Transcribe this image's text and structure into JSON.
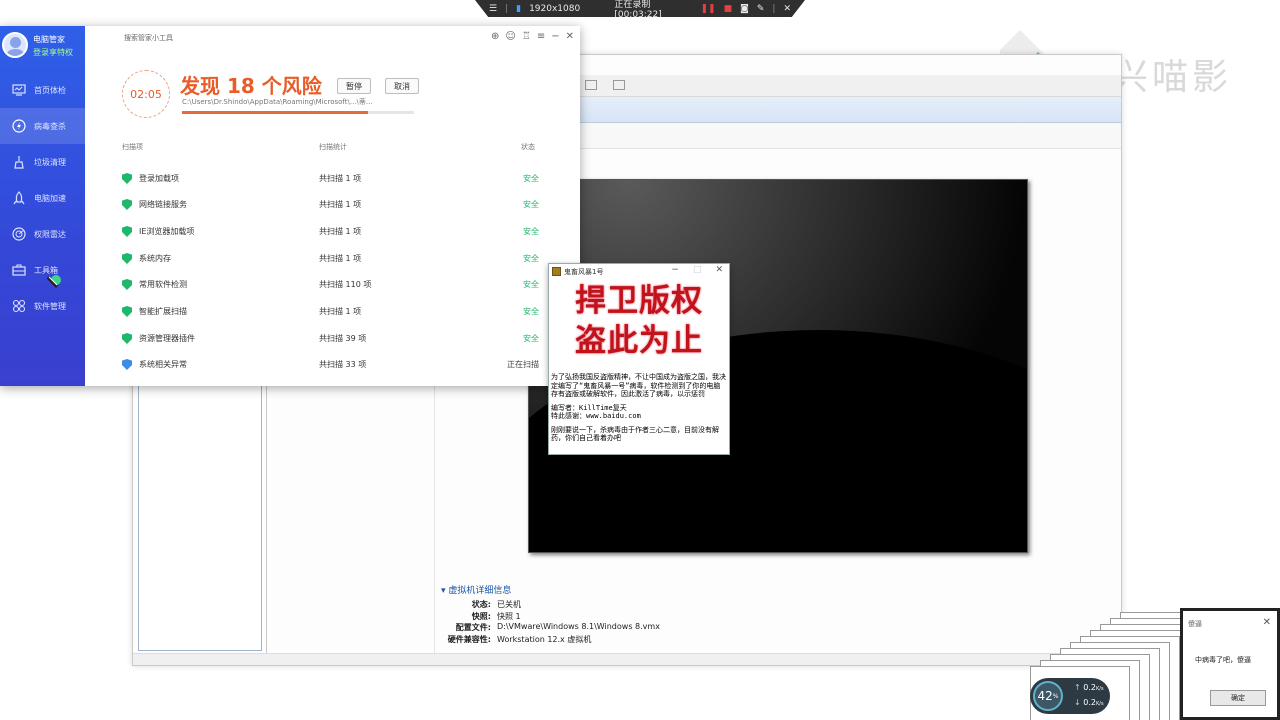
{
  "recorder": {
    "menu_icon": "menu-icon",
    "resolution": "1920x1080",
    "status": "正在录制 [00:03:22]",
    "pause_icon": "pause-icon",
    "stop_icon": "stop-icon",
    "camera_icon": "camera-icon",
    "pen_icon": "pen-icon",
    "close_icon": "close-icon"
  },
  "watermark": {
    "text": "万兴喵影"
  },
  "manager": {
    "user_name": "电脑管家",
    "login_text": "登录享特权",
    "sidebar": [
      {
        "label": "首页体检",
        "icon": "monitor-icon"
      },
      {
        "label": "病毒查杀",
        "icon": "lightning-icon"
      },
      {
        "label": "垃圾清理",
        "icon": "broom-icon"
      },
      {
        "label": "电脑加速",
        "icon": "rocket-icon"
      },
      {
        "label": "权限雷达",
        "icon": "radar-icon"
      },
      {
        "label": "工具箱",
        "icon": "toolbox-icon"
      },
      {
        "label": "软件管理",
        "icon": "apps-icon"
      }
    ],
    "title": "搜索管家小工具",
    "timer": "02:05",
    "risk_title": "发现 18 个风险",
    "pause_label": "暂停",
    "cancel_label": "取消",
    "scan_path": "C:\\Users\\Dr.Shindo\\AppData\\Roaming\\Microsoft\\...\\蒂...",
    "progress": 0.8,
    "columns": {
      "item": "扫描项",
      "stats": "扫描统计",
      "status": "状态"
    },
    "rows": [
      {
        "name": "登录加载项",
        "count": "共扫描 1 项",
        "status": "安全"
      },
      {
        "name": "网络链接服务",
        "count": "共扫描 1 项",
        "status": "安全"
      },
      {
        "name": "IE浏览器加载项",
        "count": "共扫描 1 项",
        "status": "安全"
      },
      {
        "name": "系统内存",
        "count": "共扫描 1 项",
        "status": "安全"
      },
      {
        "name": "常用软件检测",
        "count": "共扫描 110 项",
        "status": "安全"
      },
      {
        "name": "智能扩展扫描",
        "count": "共扫描 1 项",
        "status": "安全"
      },
      {
        "name": "资源管理器插件",
        "count": "共扫描 39 项",
        "status": "安全"
      },
      {
        "name": "系统相关异常",
        "count": "共扫描 33 项",
        "status": "正在扫描"
      }
    ]
  },
  "vm": {
    "details_title": "虚拟机详细信息",
    "details": [
      {
        "label": "状态:",
        "value": "已关机"
      },
      {
        "label": "快照:",
        "value": "快照 1"
      },
      {
        "label": "配置文件:",
        "value": "D:\\VMware\\Windows 8.1\\Windows 8.vmx"
      },
      {
        "label": "硬件兼容性:",
        "value": "Workstation 12.x 虚拟机"
      }
    ]
  },
  "virus": {
    "title": "鬼畜风暴1号",
    "banner_line1": "捍卫版权",
    "banner_line2": "盗此为止",
    "body_line1": "为了弘扬我国反盗版精神，不让中国成为盗版之国，我决定编写了“鬼畜风暴一号”病毒，软件检测到了你的电脑存有盗版或破解软件，因此激活了病毒，以示惩罚",
    "body_line2": "编写者：KillTime复天",
    "body_line3": "特此感谢：www.baidu.com",
    "body_line4": "刚刚要说一下，杀病毒由于作者三心二意，目前没有解药，你们自己看着办吧"
  },
  "alert": {
    "title": "傻逼",
    "message": "中病毒了吧，傻逼",
    "ok_label": "确定"
  },
  "speed": {
    "percent": "42",
    "unit": "%",
    "up": "0.2",
    "down": "0.2",
    "rate_unit": "K/s"
  }
}
